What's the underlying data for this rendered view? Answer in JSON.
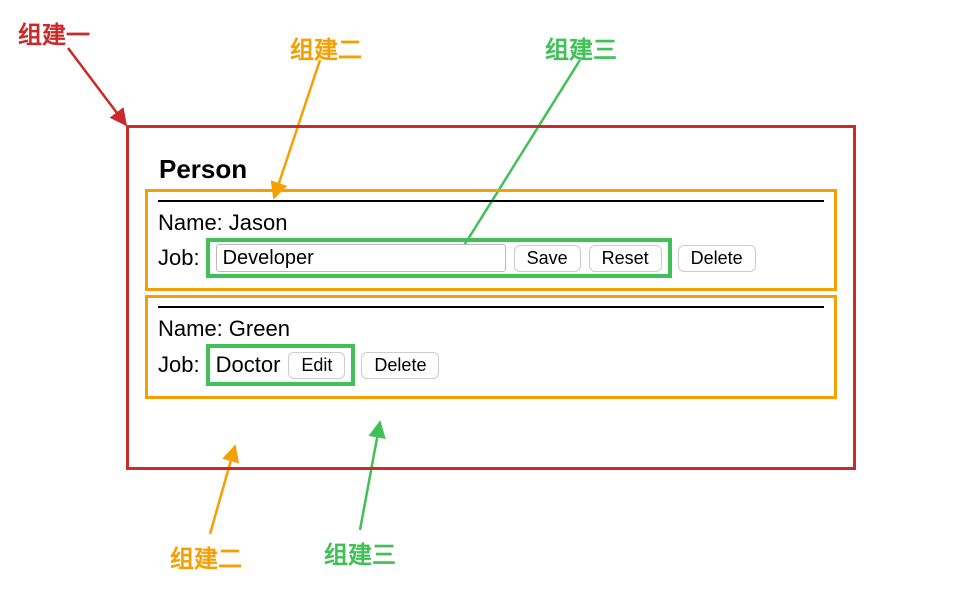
{
  "annotations": {
    "one_label": "组建一",
    "two_label": "组建二",
    "three_label": "组建三",
    "two_label_bottom": "组建二",
    "three_label_bottom": "组建三"
  },
  "panel": {
    "title": "Person"
  },
  "persons": [
    {
      "name_label": "Name:",
      "name_value": "Jason",
      "job_label": "Job:",
      "job_value": "Developer",
      "save_btn": "Save",
      "reset_btn": "Reset",
      "delete_btn": "Delete",
      "mode": "edit"
    },
    {
      "name_label": "Name:",
      "name_value": "Green",
      "job_label": "Job:",
      "job_value": "Doctor",
      "edit_btn": "Edit",
      "delete_btn": "Delete",
      "mode": "view"
    }
  ]
}
